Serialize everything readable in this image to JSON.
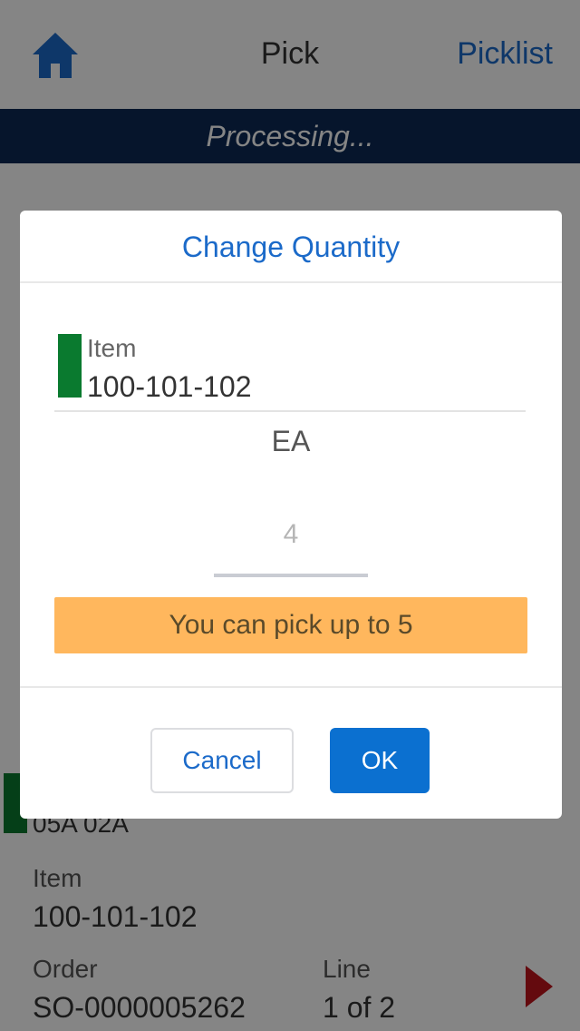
{
  "header": {
    "title": "Pick",
    "picklist_link": "Picklist",
    "home_icon": "home-icon"
  },
  "status_bar": {
    "text": "Processing..."
  },
  "background": {
    "location": "05A 02A",
    "item_label": "Item",
    "item_value": "100-101-102",
    "order_label": "Order",
    "order_value": "SO-0000005262",
    "line_label": "Line",
    "line_value": "1 of 2",
    "next_icon": "play-arrow-icon"
  },
  "modal": {
    "title": "Change Quantity",
    "item_label": "Item",
    "item_value": "100-101-102",
    "uom": "EA",
    "quantity_placeholder": "4",
    "notice": "You can pick up to 5",
    "cancel_label": "Cancel",
    "ok_label": "OK"
  },
  "colors": {
    "accent": "#1b6ac9",
    "status_bar": "#0c2a55",
    "marker_green": "#0a7a2f",
    "notice_orange": "#ffb75d",
    "ok_button": "#0b70d0",
    "next_arrow": "#c0141c"
  }
}
